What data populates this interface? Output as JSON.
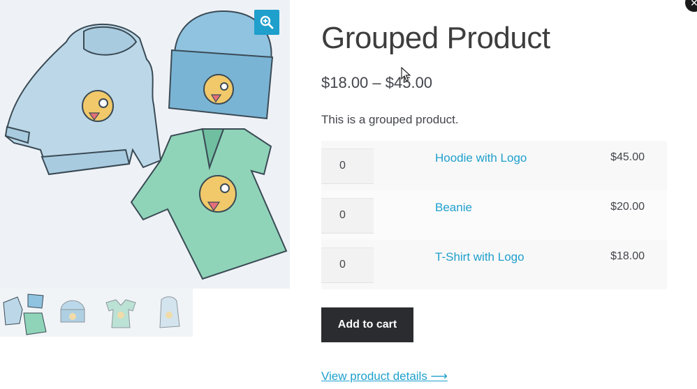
{
  "product": {
    "title": "Grouped Product",
    "price_range": "$18.00 – $45.00",
    "description": "This is a grouped product."
  },
  "grouped_items": [
    {
      "qty": "0",
      "name": "Hoodie with Logo",
      "price": "$45.00"
    },
    {
      "qty": "0",
      "name": "Beanie",
      "price": "$20.00"
    },
    {
      "qty": "0",
      "name": "T-Shirt with Logo",
      "price": "$18.00"
    }
  ],
  "actions": {
    "add_to_cart": "Add to cart",
    "view_details": "View product details ⟶"
  },
  "icons": {
    "zoom": "zoom-in-icon",
    "close": "close-icon",
    "cursor": "mouse-cursor-icon"
  },
  "colors": {
    "accent": "#1e9fcc",
    "button": "#2b2c30",
    "hoodie": "#bcd8e8",
    "beanie": "#8fc3e0",
    "tshirt": "#8fd4b8",
    "emoji": "#f1c96a"
  },
  "gallery": {
    "thumbnails": [
      "grouped-product-thumb",
      "beanie-thumb",
      "tshirt-thumb",
      "hoodie-thumb"
    ]
  }
}
